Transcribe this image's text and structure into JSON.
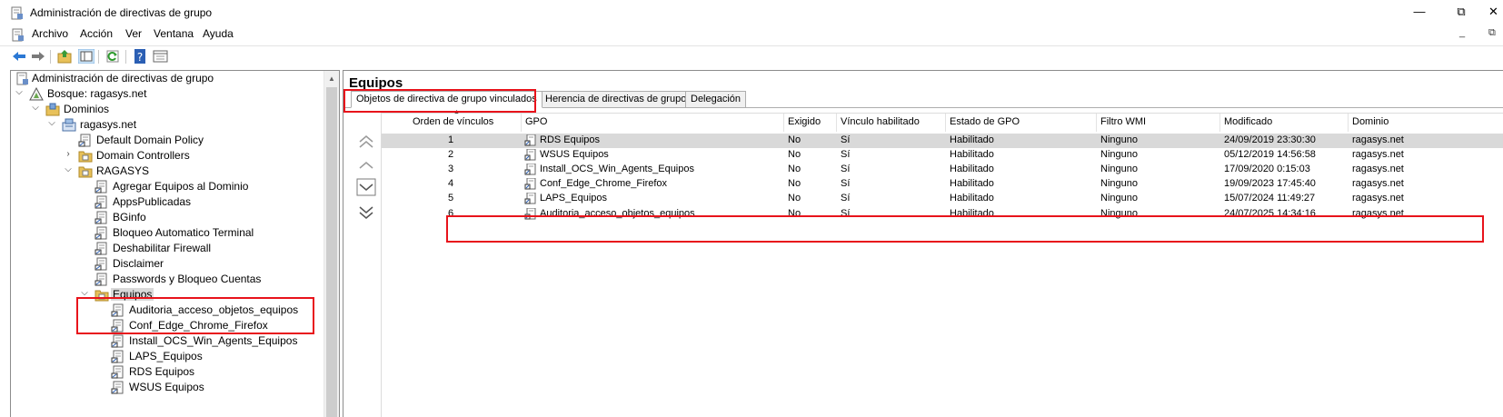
{
  "window": {
    "title": "Administración de directivas de grupo",
    "buttons": [
      "—",
      "⧉",
      "✕"
    ]
  },
  "menu": [
    "Archivo",
    "Acción",
    "Ver",
    "Ventana",
    "Ayuda"
  ],
  "mdi_buttons": [
    "_",
    "⧉"
  ],
  "toolbar": [
    "back-arrow-icon",
    "forward-arrow-icon",
    "up-folder-icon",
    "show-hide-tree-icon",
    "refresh-icon",
    "help-icon",
    "properties-icon"
  ],
  "tree": {
    "root": "Administración de directivas de grupo",
    "forest": "Bosque: ragasys.net",
    "domains": "Dominios",
    "domain": "ragasys.net",
    "domain_children": [
      "Default Domain Policy",
      "Domain Controllers",
      "RAGASYS"
    ],
    "ragasys_children": [
      "Agregar Equipos al Dominio",
      "AppsPublicadas",
      "BGinfo",
      "Bloqueo Automatico Terminal",
      "Deshabilitar Firewall",
      "Disclaimer",
      "Passwords y Bloqueo Cuentas",
      "Equipos"
    ],
    "equipos_children": [
      "Auditoria_acceso_objetos_equipos",
      "Conf_Edge_Chrome_Firefox",
      "Install_OCS_Win_Agents_Equipos",
      "LAPS_Equipos",
      "RDS Equipos",
      "WSUS Equipos"
    ]
  },
  "right": {
    "title": "Equipos",
    "tabs": [
      "Objetos de directiva de grupo vinculados",
      "Herencia de directivas de grupo",
      "Delegación"
    ],
    "columns": [
      "Orden de vínculos",
      "GPO",
      "Exigido",
      "Vínculo habilitado",
      "Estado de GPO",
      "Filtro WMI",
      "Modificado",
      "Dominio"
    ],
    "rows": [
      [
        "1",
        "RDS Equipos",
        "No",
        "Sí",
        "Habilitado",
        "Ninguno",
        "24/09/2019 23:30:30",
        "ragasys.net"
      ],
      [
        "2",
        "WSUS Equipos",
        "No",
        "Sí",
        "Habilitado",
        "Ninguno",
        "05/12/2019 14:56:58",
        "ragasys.net"
      ],
      [
        "3",
        "Install_OCS_Win_Agents_Equipos",
        "No",
        "Sí",
        "Habilitado",
        "Ninguno",
        "17/09/2020 0:15:03",
        "ragasys.net"
      ],
      [
        "4",
        "Conf_Edge_Chrome_Firefox",
        "No",
        "Sí",
        "Habilitado",
        "Ninguno",
        "19/09/2023 17:45:40",
        "ragasys.net"
      ],
      [
        "5",
        "LAPS_Equipos",
        "No",
        "Sí",
        "Habilitado",
        "Ninguno",
        "15/07/2024 11:49:27",
        "ragasys.net"
      ],
      [
        "6",
        "Auditoria_acceso_objetos_equipos",
        "No",
        "Sí",
        "Habilitado",
        "Ninguno",
        "24/07/2025 14:34:16",
        "ragasys.net"
      ]
    ],
    "order_buttons": [
      "move-top-icon",
      "move-up-icon",
      "move-down-icon",
      "move-bottom-icon"
    ]
  },
  "colors": {
    "highlight": "#e8131b",
    "selected_row": "#d9d9d9",
    "folder": "#e8c15a"
  }
}
